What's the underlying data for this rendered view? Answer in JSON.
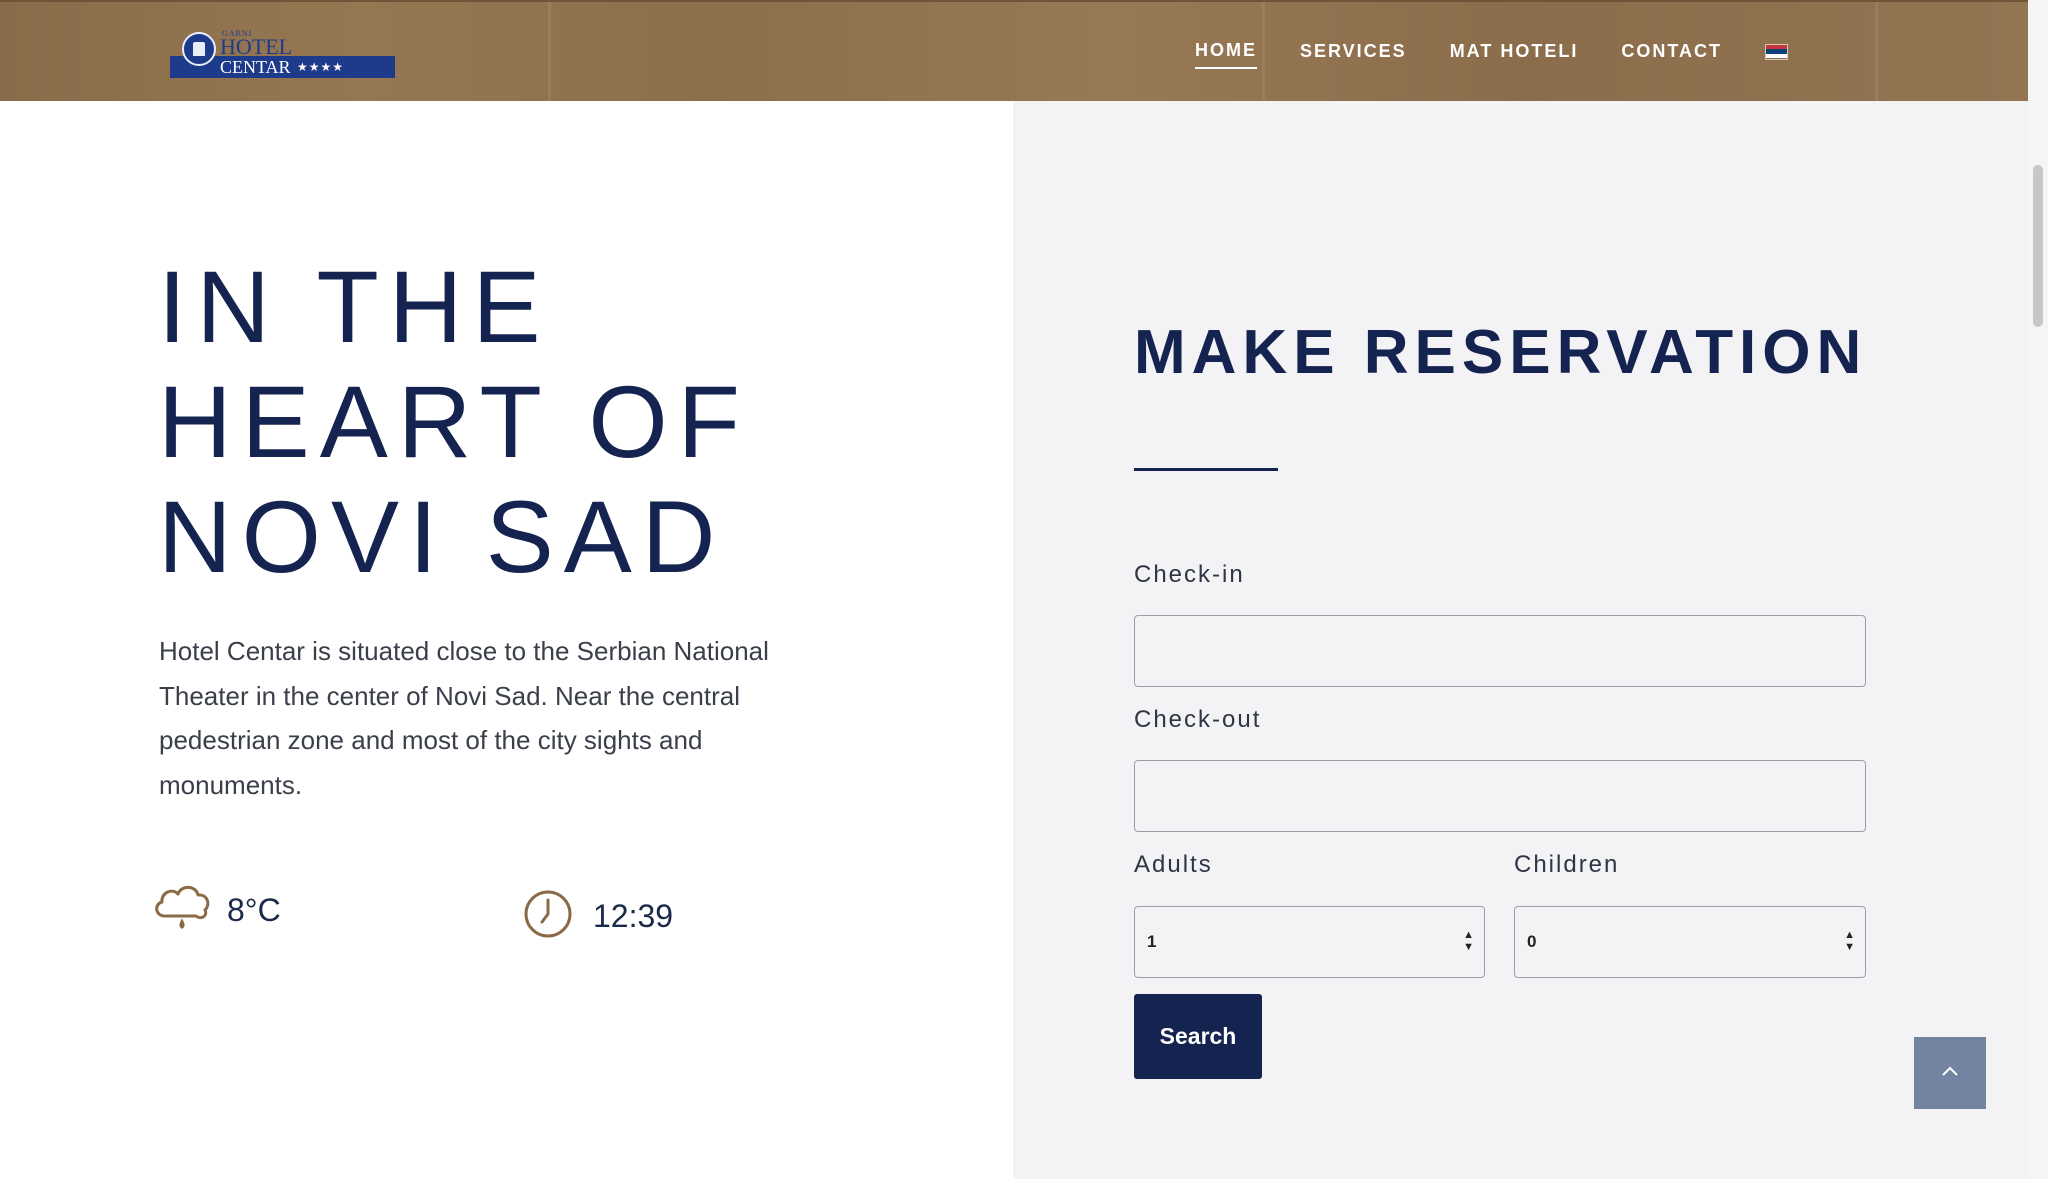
{
  "logo": {
    "small_text": "GARNI",
    "line1": "HOTEL",
    "line2": "CENTAR",
    "stars": "★★★★"
  },
  "nav": {
    "items": [
      {
        "label": "HOME",
        "active": true
      },
      {
        "label": "SERVICES",
        "active": false
      },
      {
        "label": "MAT HOTELI",
        "active": false
      },
      {
        "label": "CONTACT",
        "active": false
      }
    ],
    "language_flag": "serbian-flag-icon"
  },
  "hero": {
    "title_lines": [
      "IN THE",
      "HEART OF",
      "NOVI SAD"
    ],
    "description": "Hotel Centar is situated close to the Serbian National Theater in the center of Novi Sad. Near the central pedestrian zone and most of the city sights and monuments.",
    "weather": {
      "icon": "cloud-rain-icon",
      "temperature": "8°C"
    },
    "clock": {
      "icon": "clock-icon",
      "time": "12:39"
    }
  },
  "reservation": {
    "title": "MAKE RESERVATION",
    "checkin_label": "Check-in",
    "checkin_value": "",
    "checkout_label": "Check-out",
    "checkout_value": "",
    "adults_label": "Adults",
    "adults_value": "1",
    "children_label": "Children",
    "children_value": "0",
    "search_label": "Search"
  },
  "scroll_to_top": {
    "icon": "chevron-up-icon"
  },
  "colors": {
    "navy": "#14234f",
    "header_brown": "#8d6f4c",
    "panel_gray": "#f3f2f4",
    "accent_gold": "#8a6a45",
    "back_to_top": "#7384a3"
  }
}
